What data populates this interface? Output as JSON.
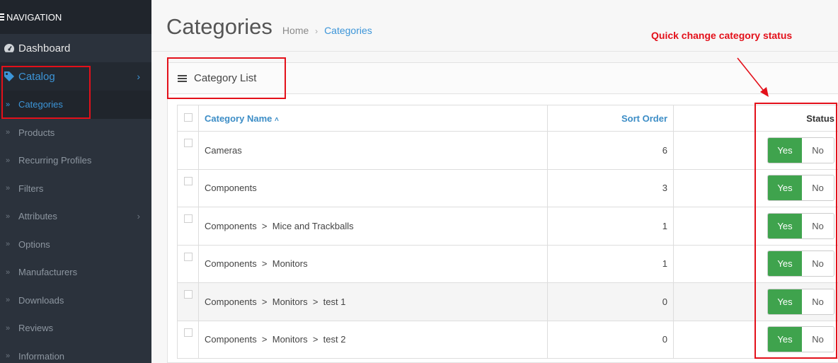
{
  "sidebar": {
    "header": "NAVIGATION",
    "dashboard": "Dashboard",
    "catalog": "Catalog",
    "items": [
      {
        "label": "Categories",
        "active": true
      },
      {
        "label": "Products"
      },
      {
        "label": "Recurring Profiles"
      },
      {
        "label": "Filters"
      },
      {
        "label": "Attributes",
        "has_children": true
      },
      {
        "label": "Options"
      },
      {
        "label": "Manufacturers"
      },
      {
        "label": "Downloads"
      },
      {
        "label": "Reviews"
      },
      {
        "label": "Information"
      }
    ]
  },
  "header": {
    "title": "Categories",
    "breadcrumb": [
      "Home",
      "Categories"
    ]
  },
  "panel": {
    "title": "Category List"
  },
  "table": {
    "columns": {
      "name": "Category Name",
      "sort": "Sort Order",
      "status": "Status"
    },
    "rows": [
      {
        "name": "Cameras",
        "sort": "6"
      },
      {
        "name": "Components",
        "sort": "3"
      },
      {
        "name": "Components  >  Mice and Trackballs",
        "sort": "1"
      },
      {
        "name": "Components  >  Monitors",
        "sort": "1"
      },
      {
        "name": "Components  >  Monitors  >  test 1",
        "sort": "0"
      },
      {
        "name": "Components  >  Monitors  >  test 2",
        "sort": "0"
      }
    ],
    "toggle": {
      "yes": "Yes",
      "no": "No"
    }
  },
  "annotation": {
    "text": "Quick change category status",
    "color": "#e3101a"
  },
  "colors": {
    "accent": "#3c95d8",
    "yes": "#3fa34d",
    "sidebar": "#2b323c"
  }
}
